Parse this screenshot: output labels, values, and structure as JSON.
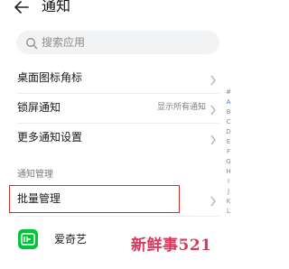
{
  "header": {
    "title": "通知"
  },
  "search": {
    "placeholder": "搜索应用"
  },
  "settings": [
    {
      "label": "桌面图标角标",
      "value": ""
    },
    {
      "label": "锁屏通知",
      "value": "显示所有通知"
    },
    {
      "label": "更多通知设置",
      "value": ""
    }
  ],
  "section": {
    "title": "通知管理"
  },
  "batch": {
    "label": "批量管理"
  },
  "apps": [
    {
      "name": "爱奇艺",
      "icon": "iqiyi-icon"
    }
  ],
  "index_letters": [
    "#",
    "A",
    "B",
    "C",
    "D",
    "E",
    "F",
    "G",
    "H",
    "I",
    "J",
    "K",
    "L"
  ],
  "index_active": "A",
  "watermark": "新鲜事521",
  "colors": {
    "accent": "#2a7ae2",
    "highlight_box": "#d42a2a",
    "app_icon": "#00c43a",
    "watermark": "#d63a5a"
  }
}
